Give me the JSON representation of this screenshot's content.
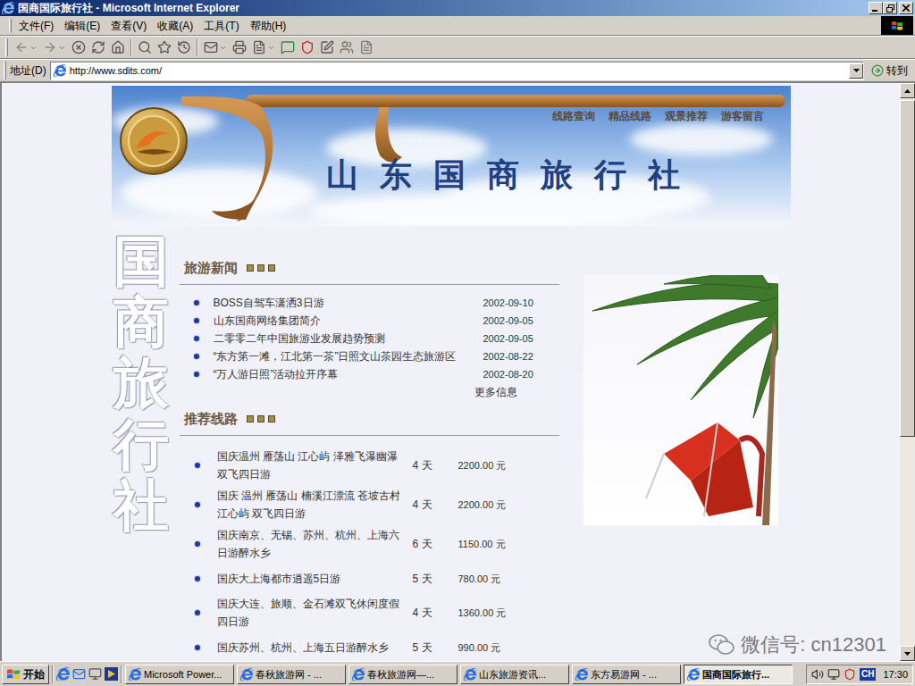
{
  "window": {
    "title": "国商国际旅行社 - Microsoft Internet Explorer"
  },
  "menu": [
    "文件(F)",
    "编辑(E)",
    "查看(V)",
    "收藏(A)",
    "工具(T)",
    "帮助(H)"
  ],
  "address": {
    "label": "地址(D)",
    "url": "http://www.sdits.com/",
    "go": "转到"
  },
  "banner": {
    "title": "山东国商旅行社",
    "nav": [
      "线路查询",
      "精品线路",
      "观景推荐",
      "游客留言"
    ]
  },
  "side_text": "国商旅行社",
  "news": {
    "heading": "旅游新闻",
    "items": [
      {
        "title": "BOSS自驾车潇洒3日游",
        "date": "2002-09-10"
      },
      {
        "title": "山东国商网络集团简介",
        "date": "2002-09-05"
      },
      {
        "title": "二零零二年中国旅游业发展趋势预测",
        "date": "2002-09-05"
      },
      {
        "title": "“东方第一滩，江北第一茶”日照文山茶园生态旅游区",
        "date": "2002-08-22"
      },
      {
        "title": "“万人游日照”活动拉开序幕",
        "date": "2002-08-20"
      }
    ],
    "more": "更多信息"
  },
  "routes": {
    "heading": "推荐线路",
    "items": [
      {
        "name": "国庆温州 雁荡山 江心屿 泽雅飞瀑幽瀑双飞四日游",
        "days": "4 天",
        "price": "2200.00 元"
      },
      {
        "name": "国庆 温州 雁荡山 楠溪江漂流 苍坡古村 江心屿 双飞四日游",
        "days": "4 天",
        "price": "2200.00 元"
      },
      {
        "name": "国庆南京、无锡、苏州、杭州、上海六日游醉水乡",
        "days": "6 天",
        "price": "1150.00 元"
      },
      {
        "name": "国庆大上海都市逍遥5日游",
        "days": "5 天",
        "price": "780.00 元"
      },
      {
        "name": "国庆大连、旅顺、金石滩双飞休闲度假四日游",
        "days": "4 天",
        "price": "1360.00 元"
      },
      {
        "name": "国庆苏州、杭州、上海五日游醉水乡",
        "days": "5 天",
        "price": "990.00 元"
      }
    ]
  },
  "watermark": "微信号: cn12301",
  "taskbar": {
    "start": "开始",
    "tasks": [
      {
        "label": "Microsoft Power...",
        "selected": false
      },
      {
        "label": "春秋旅游网 - ...",
        "selected": false
      },
      {
        "label": "春秋旅游网—...",
        "selected": false
      },
      {
        "label": "山东旅游资讯...",
        "selected": false
      },
      {
        "label": "东方易游网 - ...",
        "selected": false
      },
      {
        "label": "国商国际旅行...",
        "selected": true
      }
    ],
    "tray": {
      "lang": "CH",
      "time": "17:30"
    }
  }
}
